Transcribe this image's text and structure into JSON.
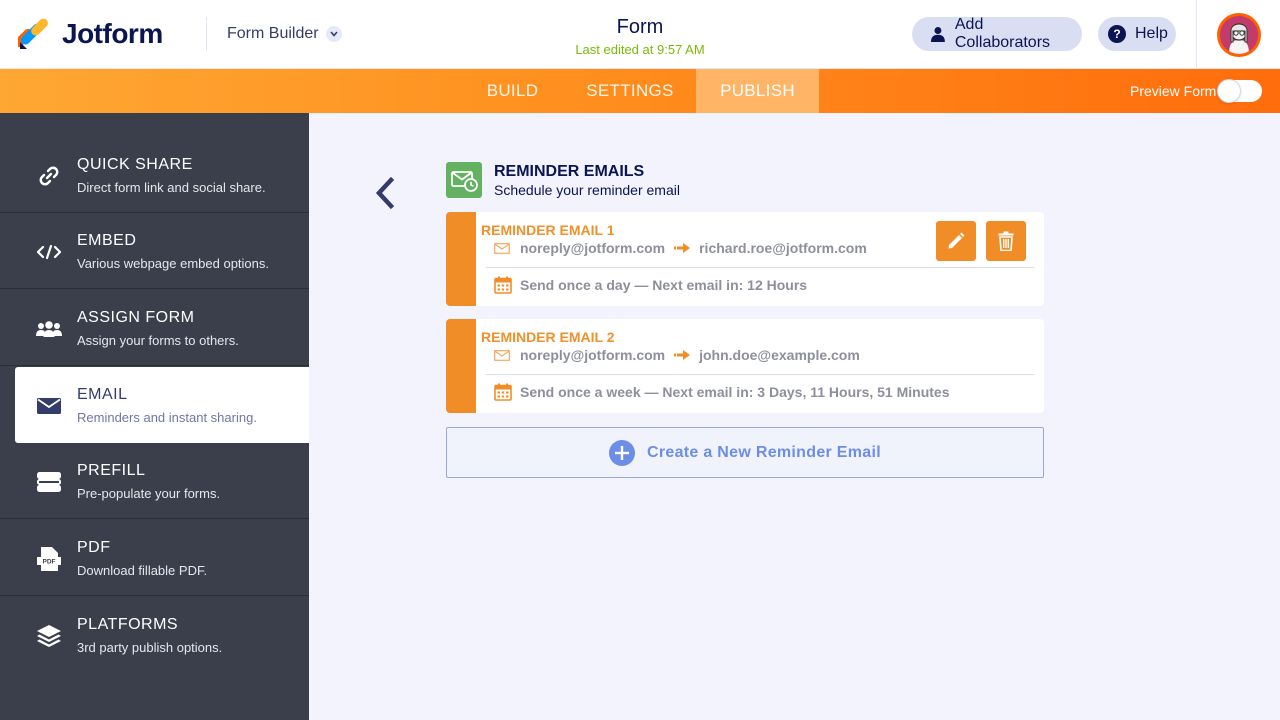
{
  "header": {
    "brand": "Jotform",
    "builder_label": "Form Builder",
    "form_title": "Form",
    "last_edited": "Last edited at 9:57 AM",
    "collaborators_label": "Add Collaborators",
    "help_label": "Help"
  },
  "nav": {
    "tabs": [
      {
        "label": "BUILD"
      },
      {
        "label": "SETTINGS"
      },
      {
        "label": "PUBLISH",
        "active": true
      }
    ],
    "preview_label": "Preview Form",
    "preview_on": false
  },
  "sidebar": {
    "items": [
      {
        "title": "QUICK SHARE",
        "desc": "Direct form link and social share.",
        "icon": "link-icon"
      },
      {
        "title": "EMBED",
        "desc": "Various webpage embed options.",
        "icon": "code-icon"
      },
      {
        "title": "ASSIGN FORM",
        "desc": "Assign your forms to others.",
        "icon": "users-icon"
      },
      {
        "title": "EMAIL",
        "desc": "Reminders and instant sharing.",
        "icon": "envelope-icon",
        "active": true
      },
      {
        "title": "PREFILL",
        "desc": "Pre-populate your forms.",
        "icon": "prefill-icon"
      },
      {
        "title": "PDF",
        "desc": "Download fillable PDF.",
        "icon": "pdf-icon",
        "pdf_text": "PDF"
      },
      {
        "title": "PLATFORMS",
        "desc": "3rd party publish options.",
        "icon": "layers-icon"
      }
    ]
  },
  "section": {
    "title": "REMINDER EMAILS",
    "subtitle": "Schedule your reminder email"
  },
  "reminders": [
    {
      "name": "REMINDER EMAIL 1",
      "from": "noreply@jotform.com",
      "to": "richard.roe@jotform.com",
      "schedule": "Send once a day — Next email in: 12 Hours"
    },
    {
      "name": "REMINDER EMAIL 2",
      "from": "noreply@jotform.com",
      "to": "john.doe@example.com",
      "schedule": "Send once a week — Next email in: 3 Days, 11 Hours, 51 Minutes"
    }
  ],
  "create_label": "Create a New Reminder Email",
  "colors": {
    "accent_orange": "#f18d27",
    "sidebar_bg": "#3b3f4c",
    "section_icon_green": "#64b261",
    "create_blue": "#6c8ee6",
    "last_edited_green": "#78bb07"
  }
}
